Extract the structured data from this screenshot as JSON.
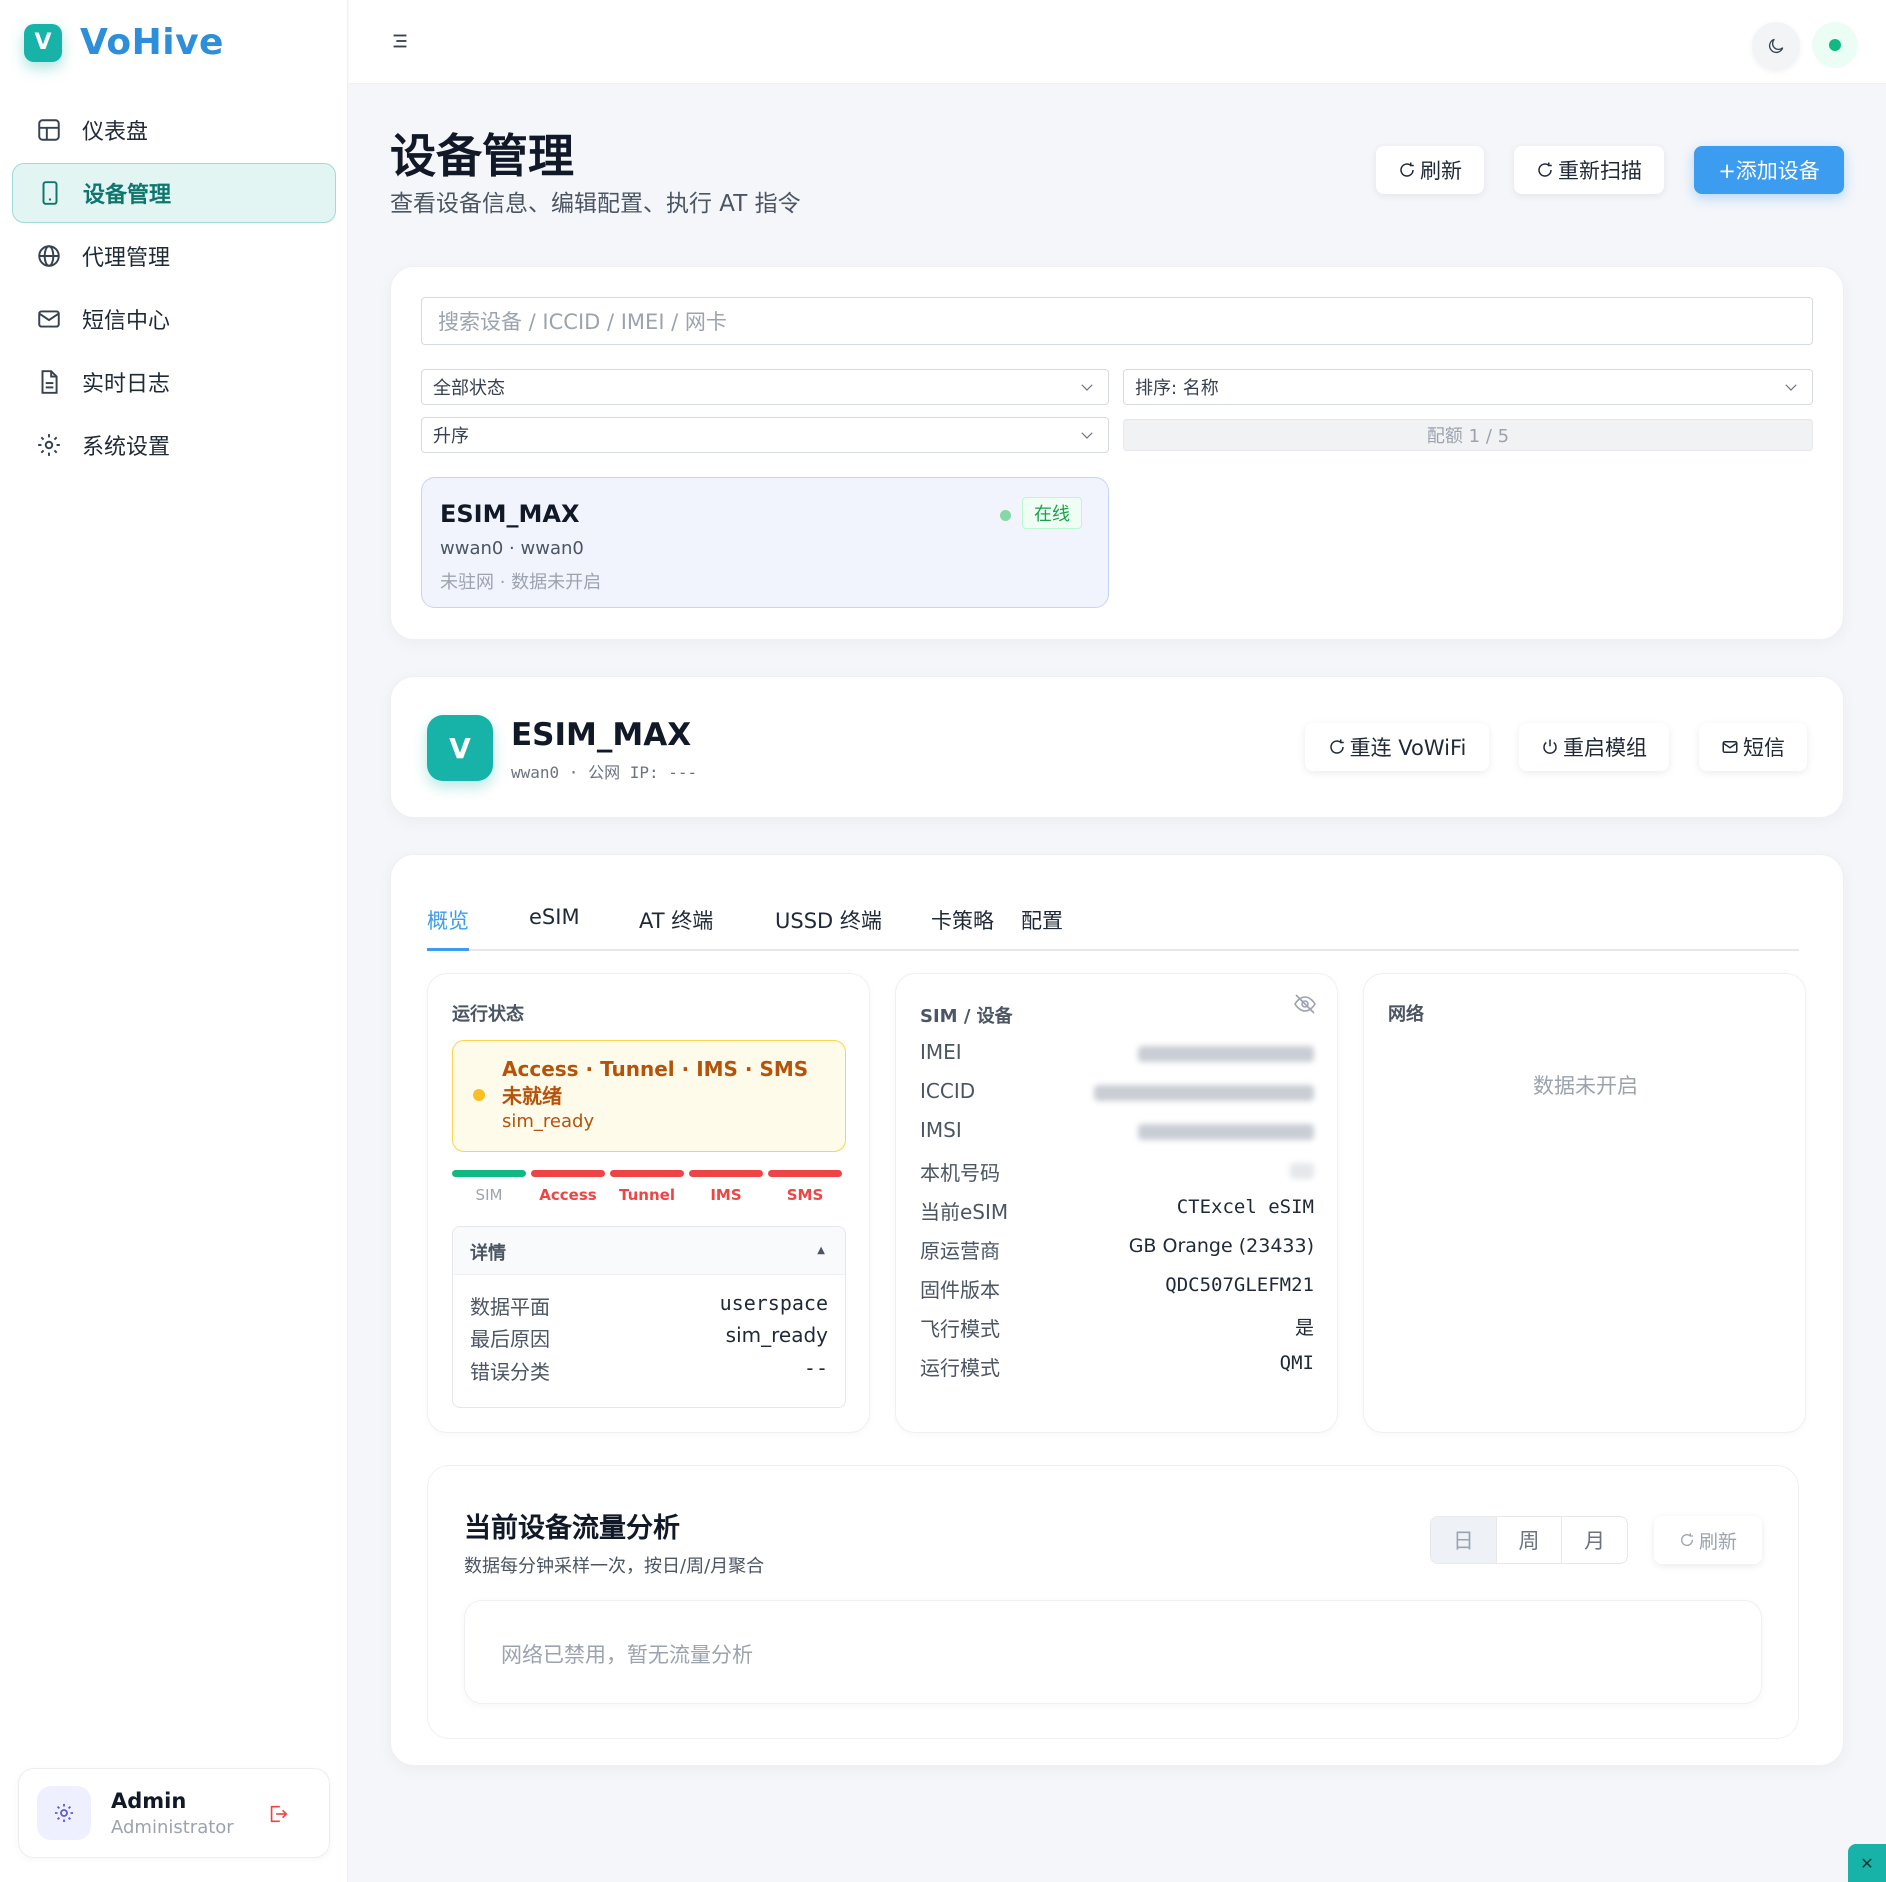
{
  "app": {
    "logo_letter": "V",
    "name": "VoHive"
  },
  "sidebar": {
    "items": [
      {
        "label": "仪表盘",
        "icon": "dashboard-icon"
      },
      {
        "label": "设备管理",
        "icon": "phone-icon",
        "active": true
      },
      {
        "label": "代理管理",
        "icon": "globe-icon"
      },
      {
        "label": "短信中心",
        "icon": "mail-icon"
      },
      {
        "label": "实时日志",
        "icon": "document-icon"
      },
      {
        "label": "系统设置",
        "icon": "gear-icon"
      }
    ],
    "user": {
      "name": "Admin",
      "role": "Administrator"
    }
  },
  "page": {
    "title": "设备管理",
    "subtitle": "查看设备信息、编辑配置、执行 AT 指令",
    "actions": {
      "refresh": "刷新",
      "rescan": "重新扫描",
      "add_device": "+添加设备"
    }
  },
  "filters": {
    "search_placeholder": "搜索设备 / ICCID / IMEI / 网卡",
    "status": "全部状态",
    "sort": "排序: 名称",
    "order": "升序",
    "quota": "配额 1 / 5"
  },
  "device_list": [
    {
      "name": "ESIM_MAX",
      "iface": "wwan0 · wwan0",
      "state": "未驻网 · 数据未开启",
      "badge": "在线"
    }
  ],
  "device_header": {
    "avatar_letter": "V",
    "name": "ESIM_MAX",
    "sub": "wwan0 · 公网 IP: ---",
    "actions": {
      "reconnect": "重连 VoWiFi",
      "restart": "重启模组",
      "sms": "短信"
    }
  },
  "tabs": [
    "概览",
    "eSIM",
    "AT 终端",
    "USSD 终端",
    "卡策略",
    "配置"
  ],
  "run_status": {
    "title": "运行状态",
    "alert_title": "Access · Tunnel · IMS · SMS 未就绪",
    "alert_sub": "sim_ready",
    "stages": [
      {
        "label": "SIM",
        "ok": true
      },
      {
        "label": "Access",
        "ok": false
      },
      {
        "label": "Tunnel",
        "ok": false
      },
      {
        "label": "IMS",
        "ok": false
      },
      {
        "label": "SMS",
        "ok": false
      }
    ],
    "details_title": "详情",
    "details": [
      {
        "k": "数据平面",
        "v": "userspace"
      },
      {
        "k": "最后原因",
        "v": "sim_ready"
      },
      {
        "k": "错误分类",
        "v": "--"
      }
    ]
  },
  "sim_device": {
    "title": "SIM / 设备",
    "rows": [
      {
        "k": "IMEI",
        "v": ""
      },
      {
        "k": "ICCID",
        "v": ""
      },
      {
        "k": "IMSI",
        "v": ""
      },
      {
        "k": "本机号码",
        "v": ""
      },
      {
        "k": "当前eSIM",
        "v": "CTExcel eSIM"
      },
      {
        "k": "原运营商",
        "v": "GB Orange (23433)"
      },
      {
        "k": "固件版本",
        "v": "QDC507GLEFM21"
      },
      {
        "k": "飞行模式",
        "v": "是"
      },
      {
        "k": "运行模式",
        "v": "QMI"
      }
    ]
  },
  "network": {
    "title": "网络",
    "empty": "数据未开启"
  },
  "traffic": {
    "title": "当前设备流量分析",
    "subtitle": "数据每分钟采样一次，按日/周/月聚合",
    "periods": [
      "日",
      "周",
      "月"
    ],
    "refresh": "刷新",
    "empty": "网络已禁用，暂无流量分析"
  },
  "colors": {
    "accent": "#3b9cf0",
    "brand": "#17b3a9",
    "ok": "#10b981",
    "error": "#ef4444",
    "warn": "#b45309"
  }
}
